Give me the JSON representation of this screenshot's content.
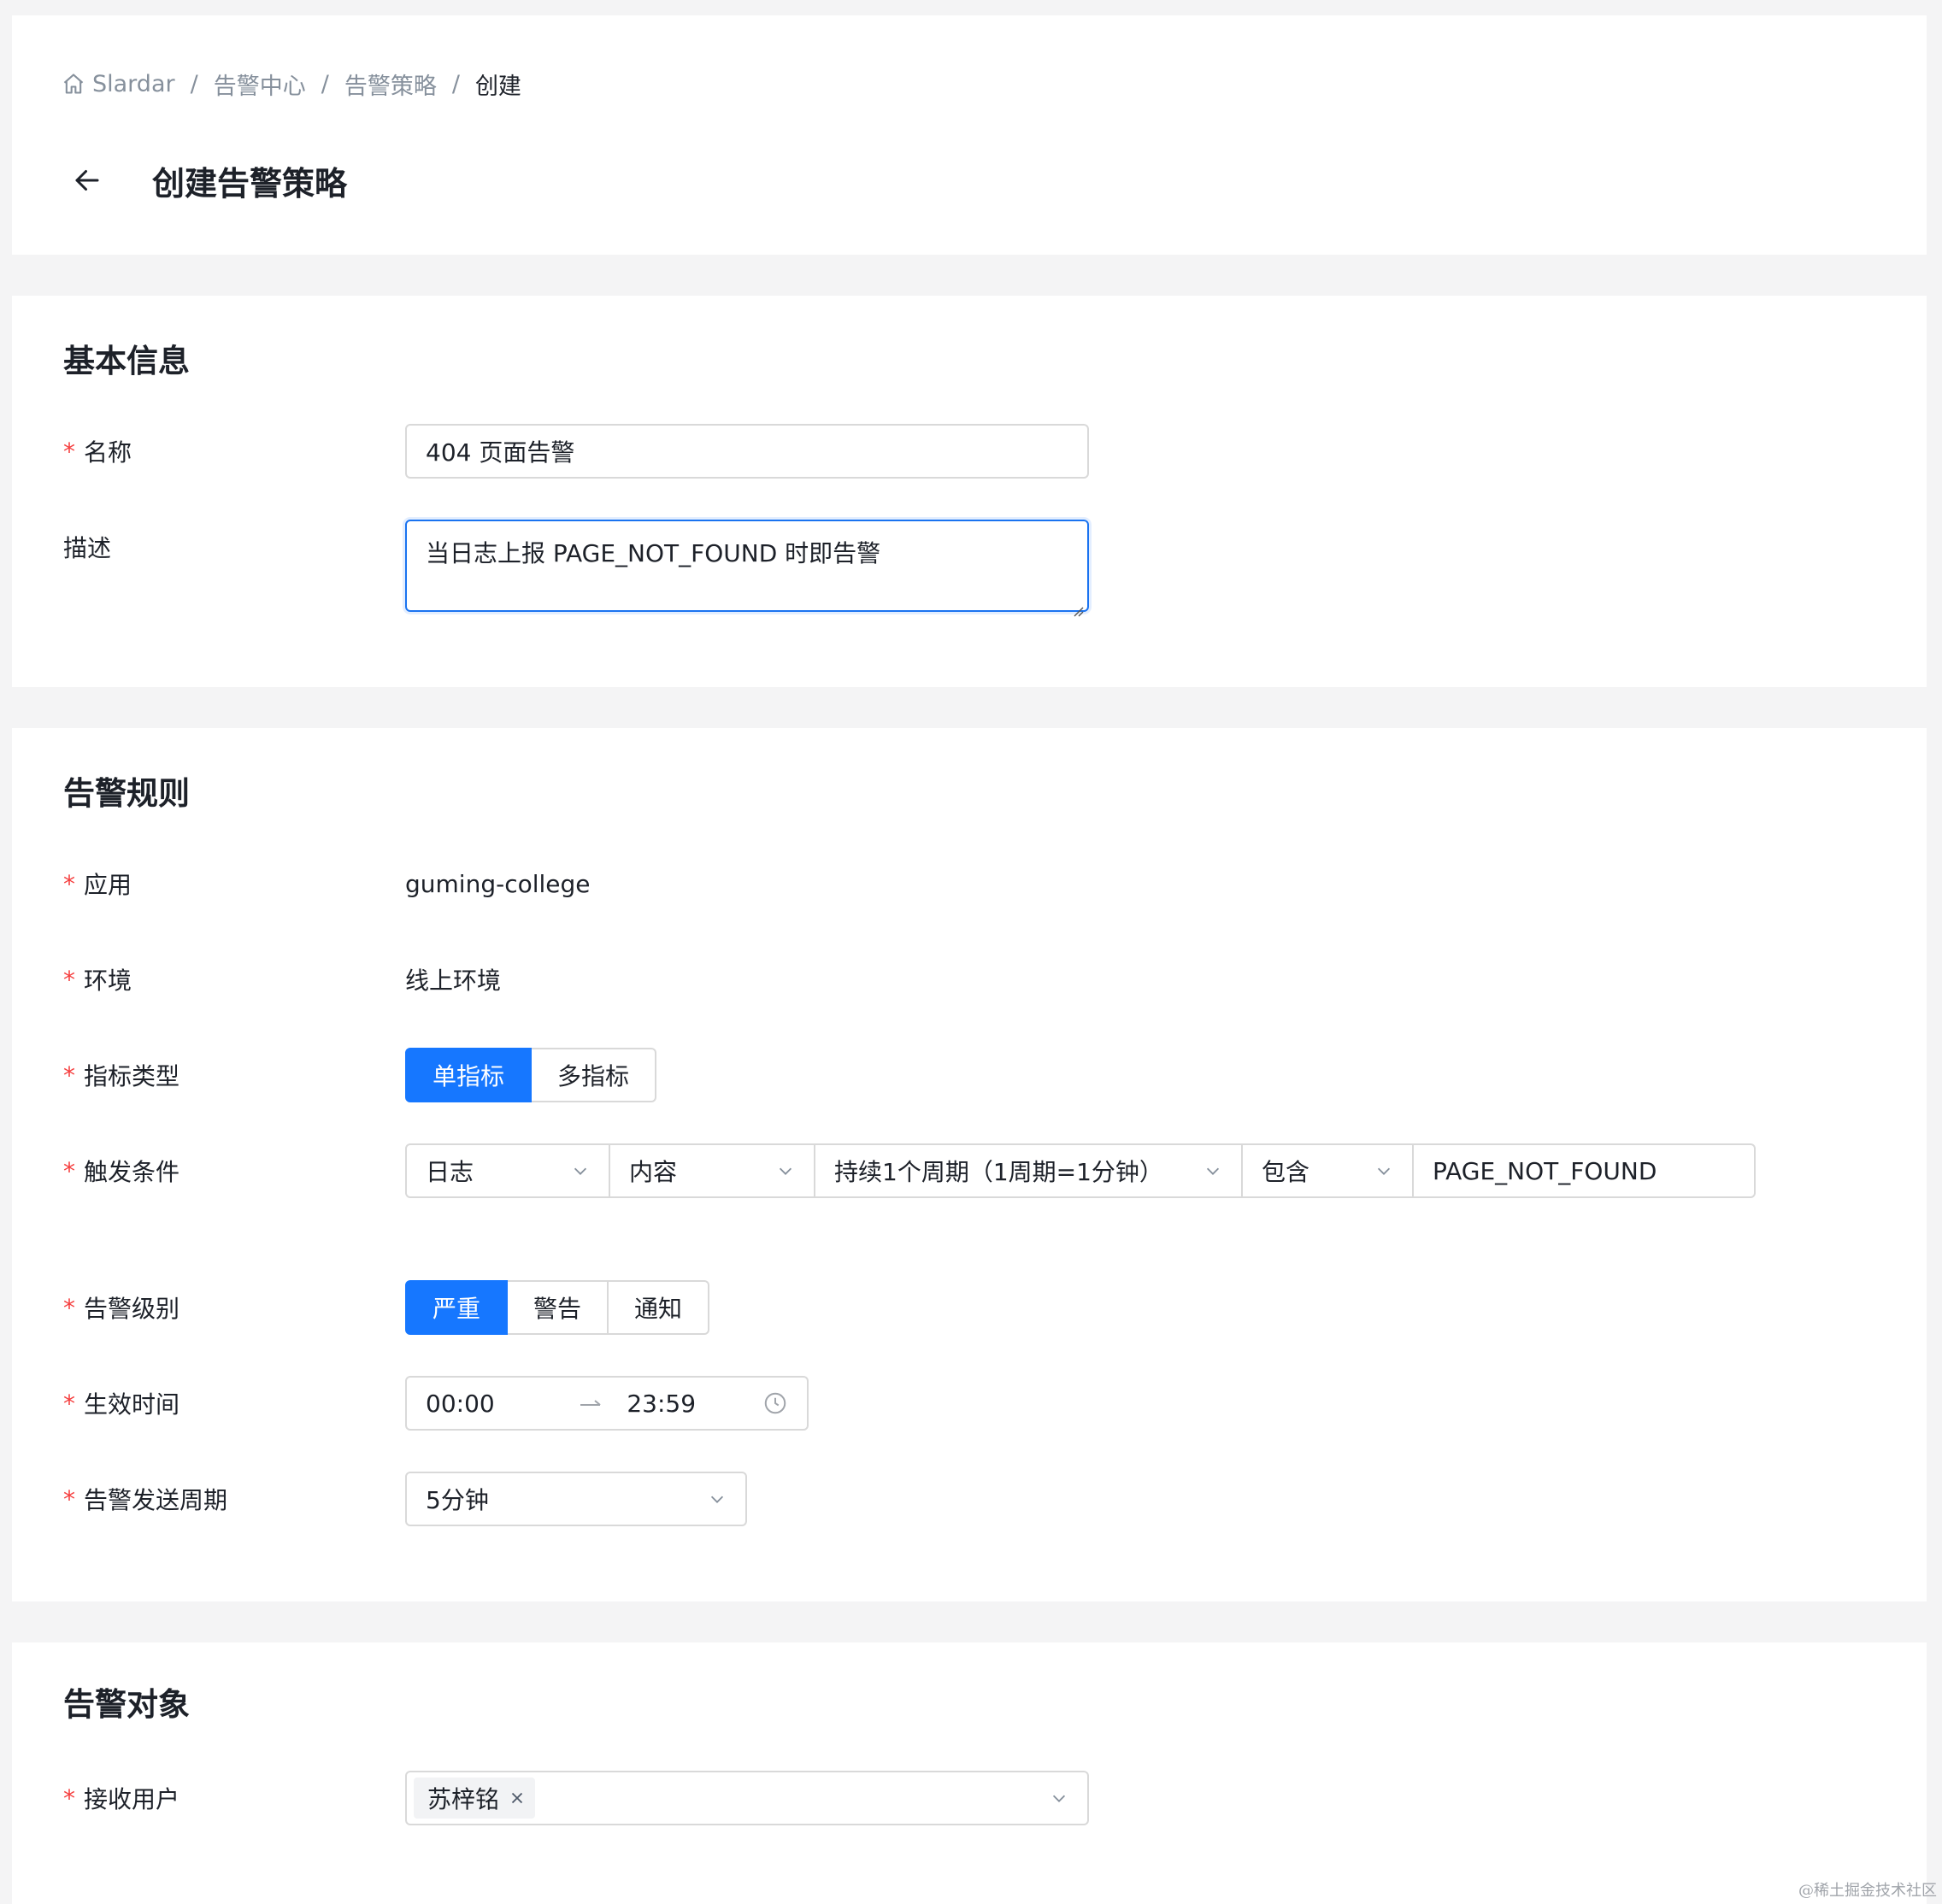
{
  "breadcrumb": {
    "items": [
      "Slardar",
      "告警中心",
      "告警策略"
    ],
    "current": "创建",
    "separator": "/"
  },
  "page": {
    "title": "创建告警策略"
  },
  "basic": {
    "title": "基本信息",
    "name_label": "名称",
    "name_value": "404 页面告警",
    "desc_label": "描述",
    "desc_value": "当日志上报 PAGE_NOT_FOUND 时即告警"
  },
  "rules": {
    "title": "告警规则",
    "app_label": "应用",
    "app_value": "guming-college",
    "env_label": "环境",
    "env_value": "线上环境",
    "metric_label": "指标类型",
    "metric_options": [
      "单指标",
      "多指标"
    ],
    "metric_selected": "单指标",
    "trigger_label": "触发条件",
    "trigger": {
      "source": "日志",
      "field": "内容",
      "period": "持续1个周期（1周期=1分钟）",
      "operator": "包含",
      "value": "PAGE_NOT_FOUND"
    },
    "level_label": "告警级别",
    "level_options": [
      "严重",
      "警告",
      "通知"
    ],
    "level_selected": "严重",
    "time_label": "生效时间",
    "time_start": "00:00",
    "time_end": "23:59",
    "cycle_label": "告警发送周期",
    "cycle_value": "5分钟"
  },
  "target": {
    "title": "告警对象",
    "users_label": "接收用户",
    "users": [
      "苏梓铭"
    ]
  },
  "footer": {
    "watermark": "@稀土掘金技术社区"
  },
  "colors": {
    "primary": "#1677ff",
    "required": "#f53f3f",
    "border": "#d9d9d9"
  },
  "icons": {
    "home": "home-icon",
    "back": "arrow-left-icon",
    "chevron": "chevron-down-icon",
    "clock": "clock-icon",
    "arrow": "arrow-right-icon",
    "close": "close-icon"
  }
}
